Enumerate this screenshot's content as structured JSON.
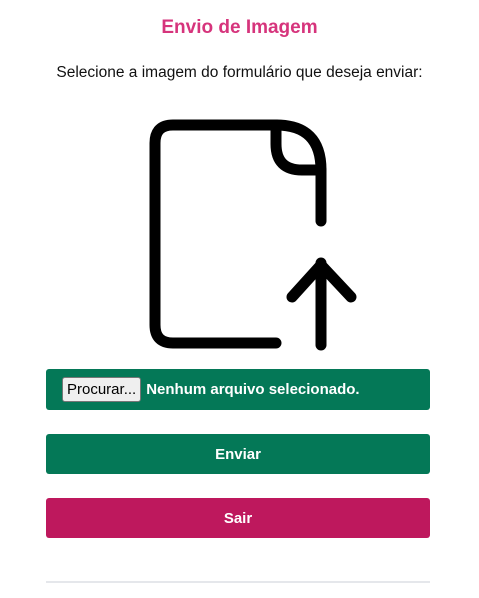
{
  "page": {
    "title": "Envio de Imagem",
    "instruction": "Selecione a imagem do formulário que deseja enviar:"
  },
  "icon": {
    "name": "file-upload-icon"
  },
  "file_input": {
    "browse_label": "Procurar...",
    "status_text": "Nenhum arquivo selecionado."
  },
  "actions": {
    "send_label": "Enviar",
    "exit_label": "Sair"
  },
  "colors": {
    "title": "#d6347c",
    "primary_green": "#047857",
    "exit_magenta": "#be185d"
  }
}
